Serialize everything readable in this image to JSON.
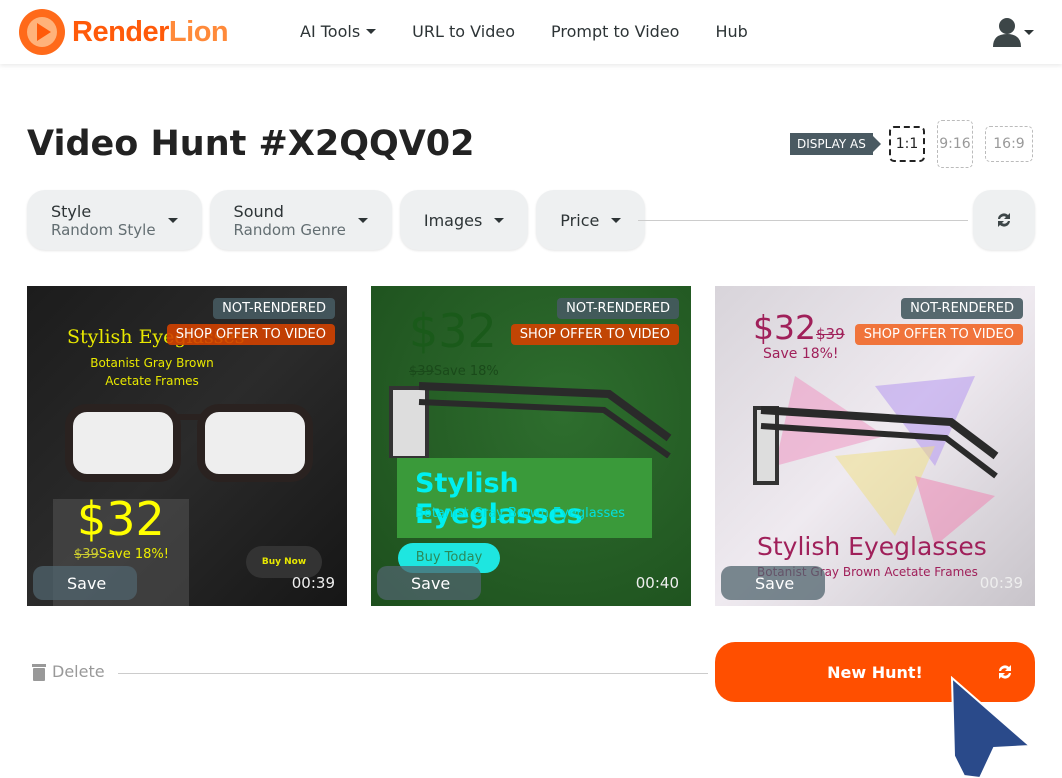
{
  "nav": {
    "brand_a": "Render",
    "brand_b": "Lion",
    "items": [
      {
        "label": "AI Tools",
        "dropdown": true
      },
      {
        "label": "URL to Video"
      },
      {
        "label": "Prompt to Video"
      },
      {
        "label": "Hub"
      }
    ],
    "user_icon": "user-icon"
  },
  "page": {
    "title": "Video Hunt #X2QQV02",
    "display_as": "DISPLAY AS",
    "ratios": [
      {
        "label": "1:1",
        "active": true
      },
      {
        "label": "9:16"
      },
      {
        "label": "16:9"
      }
    ]
  },
  "filters": [
    {
      "title": "Style",
      "value": "Random Style"
    },
    {
      "title": "Sound",
      "value": "Random Genre"
    },
    {
      "title": "Images"
    },
    {
      "title": "Price"
    }
  ],
  "cards": [
    {
      "status": "NOT-RENDERED",
      "shop": "SHOP OFFER TO VIDEO",
      "save": "Save",
      "duration": "00:39",
      "title": "Stylish Eyeglasses",
      "subtitle1": "Botanist Gray Brown",
      "subtitle2": "Acetate Frames",
      "price": "$32",
      "old_price": "$39",
      "save_text": "Save 18%!",
      "cta": "Buy Now"
    },
    {
      "status": "NOT-RENDERED",
      "shop": "SHOP OFFER TO VIDEO",
      "save": "Save",
      "duration": "00:40",
      "title": "Stylish Eyeglasses",
      "subtitle": "Botanist Gray Brown Eyeglasses",
      "price": "$32",
      "old_price": "$39",
      "save_text": "Save 18%",
      "cta": "Buy Today"
    },
    {
      "status": "NOT-RENDERED",
      "shop": "SHOP OFFER TO VIDEO",
      "save": "Save",
      "duration": "00:39",
      "title": "Stylish Eyeglasses",
      "subtitle": "Botanist Gray Brown Acetate Frames",
      "price": "$32",
      "old_price": "$39",
      "save_text": "Save 18%!"
    }
  ],
  "footer": {
    "delete": "Delete",
    "new_hunt": "New Hunt!"
  },
  "colors": {
    "accent": "#ff4f00",
    "brand": "#ff5a0a"
  }
}
